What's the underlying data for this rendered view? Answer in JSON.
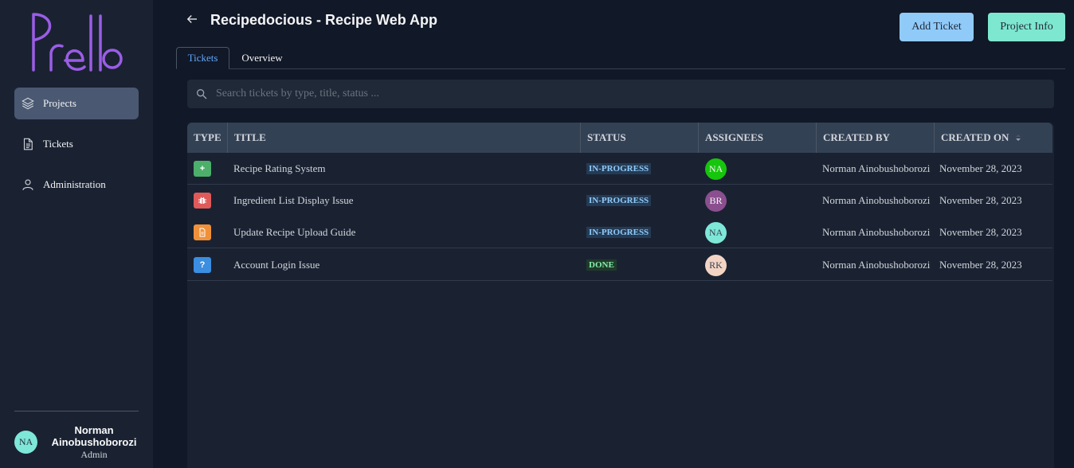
{
  "app": {
    "logo_text": "Prello"
  },
  "sidebar": {
    "items": [
      {
        "label": "Projects",
        "icon": "layers-icon",
        "active": true
      },
      {
        "label": "Tickets",
        "icon": "document-icon",
        "active": false
      },
      {
        "label": "Administration",
        "icon": "user-icon",
        "active": false
      }
    ],
    "user": {
      "initials": "NA",
      "name": "Norman Ainobushoborozi",
      "role": "Admin",
      "avatar_color": "#7ee7d8"
    }
  },
  "header": {
    "title": "Recipedocious - Recipe Web App",
    "add_ticket_label": "Add Ticket",
    "project_info_label": "Project Info"
  },
  "tabs": [
    {
      "label": "Tickets",
      "active": true
    },
    {
      "label": "Overview",
      "active": false
    }
  ],
  "search": {
    "placeholder": "Search tickets by type, title, status ..."
  },
  "table": {
    "columns": [
      "TYPE",
      "TITLE",
      "STATUS",
      "ASSIGNEES",
      "CREATED BY",
      "CREATED ON"
    ],
    "rows": [
      {
        "type": "feature",
        "type_color": "#4caf6a",
        "title": "Recipe Rating System",
        "status": "IN-PROGRESS",
        "assignee": "NA",
        "assignee_color": "#16c60c",
        "created_by": "Norman Ainobushoborozi",
        "created_on": "November 28, 2023"
      },
      {
        "type": "bug",
        "type_color": "#e05a5a",
        "title": "Ingredient List Display Issue",
        "status": "IN-PROGRESS",
        "assignee": "BR",
        "assignee_color": "#8b4f8f",
        "created_by": "Norman Ainobushoborozi",
        "created_on": "November 28, 2023"
      },
      {
        "type": "docs",
        "type_color": "#f0913a",
        "title": "Update Recipe Upload Guide",
        "status": "IN-PROGRESS",
        "assignee": "NA",
        "assignee_color": "#7ee7d8",
        "created_by": "Norman Ainobushoborozi",
        "created_on": "November 28, 2023"
      },
      {
        "type": "question",
        "type_color": "#3b8ee0",
        "title": "Account Login Issue",
        "status": "DONE",
        "assignee": "RK",
        "assignee_color": "#f3d4c4",
        "created_by": "Norman Ainobushoborozi",
        "created_on": "November 28, 2023"
      }
    ]
  },
  "colors": {
    "in_progress_bg": "#243b55",
    "in_progress_text": "#90caf9",
    "done_bg": "#1f3a2a",
    "done_text": "#86efac"
  }
}
